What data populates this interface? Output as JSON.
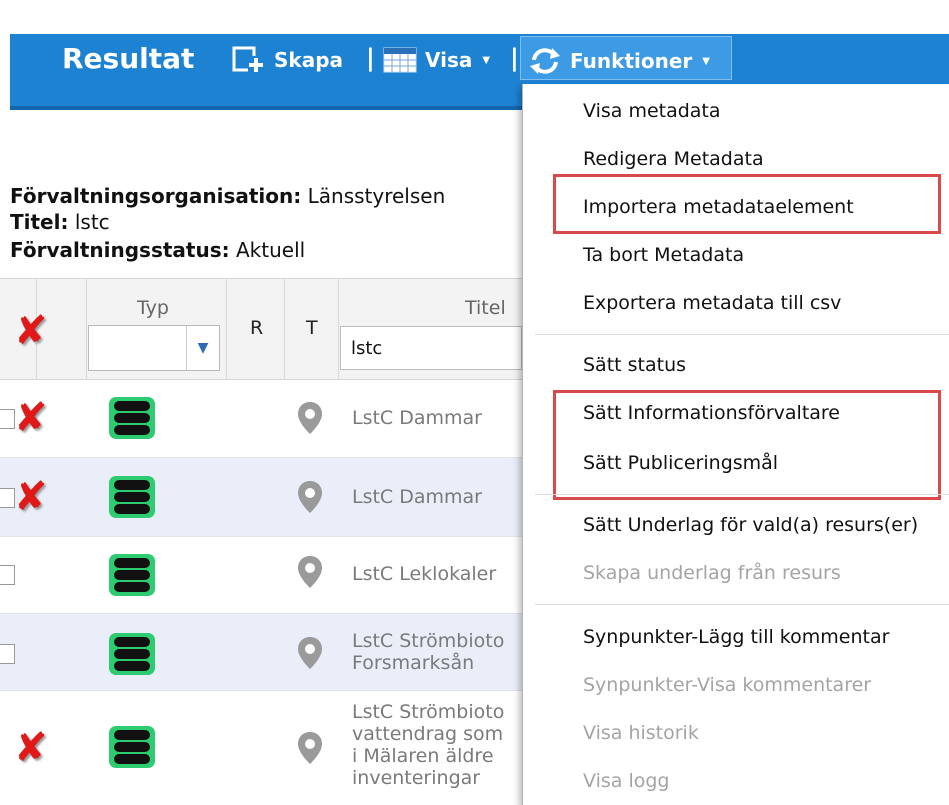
{
  "toolbar": {
    "title": "Resultat",
    "create_label": "Skapa",
    "view_label": "Visa",
    "functions_label": "Funktioner"
  },
  "info": {
    "org_label": "Förvaltningsorganisation:",
    "org_value": "Länsstyrelsen",
    "title_label": "Titel:",
    "title_value": "lstc",
    "status_label": "Förvaltningsstatus:",
    "status_value": "Aktuell"
  },
  "table": {
    "col_typ": "Typ",
    "col_r": "R",
    "col_t": "T",
    "col_titel": "Titel",
    "titel_filter": "lstc",
    "rows": [
      {
        "title": "LstC Dammar"
      },
      {
        "title": "LstC Dammar"
      },
      {
        "title": "LstC Leklokaler"
      },
      {
        "title_l1": "LstC Strömbioto",
        "title_l2": "Forsmarksån"
      },
      {
        "title_l1": "LstC Strömbioto",
        "title_l2": "vattendrag som",
        "title_l3": "i Mälaren äldre",
        "title_l4": "inventeringar"
      }
    ]
  },
  "menu": {
    "items": [
      {
        "label": "Visa metadata",
        "enabled": true
      },
      {
        "label": "Redigera Metadata",
        "enabled": true
      },
      {
        "label": "Importera metadataelement",
        "enabled": true
      },
      {
        "label": "Ta bort Metadata",
        "enabled": true
      },
      {
        "label": "Exportera metadata till csv",
        "enabled": true
      },
      {
        "label": "Sätt status",
        "enabled": true
      },
      {
        "label": "Sätt Informationsförvaltare",
        "enabled": true
      },
      {
        "label": "Sätt Publiceringsmål",
        "enabled": true
      },
      {
        "label": "Sätt Underlag för vald(a) resurs(er)",
        "enabled": true
      },
      {
        "label": "Skapa underlag från resurs",
        "enabled": false
      },
      {
        "label": "Synpunkter-Lägg till kommentar",
        "enabled": true
      },
      {
        "label": "Synpunkter-Visa kommentarer",
        "enabled": false
      },
      {
        "label": "Visa historik",
        "enabled": false
      },
      {
        "label": "Visa logg",
        "enabled": false
      }
    ]
  },
  "colors": {
    "toolbar_blue": "#1e82d2",
    "highlight_red": "#d94a4a",
    "db_green": "#2ecc71",
    "delete_red": "#e01818"
  }
}
